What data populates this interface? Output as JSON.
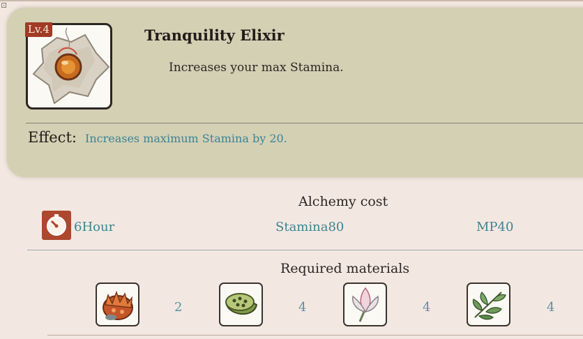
{
  "item": {
    "level_badge": "Lv.4",
    "name": "Tranquility Elixir",
    "description": "Increases your max Stamina.",
    "icon": "elixir-icon",
    "effect_label": "Effect:",
    "effect_text": "Increases maximum Stamina by 20."
  },
  "alchemy_cost": {
    "title": "Alchemy cost",
    "time_icon": "clock-icon",
    "time": "6Hour",
    "stamina": "Stamina80",
    "mp": "MP40"
  },
  "materials": {
    "title": "Required materials",
    "items": [
      {
        "icon": "fire-fruit-icon",
        "count": "2"
      },
      {
        "icon": "lotus-seedpod-icon",
        "count": "4"
      },
      {
        "icon": "lotus-bud-icon",
        "count": "4"
      },
      {
        "icon": "herb-leaves-icon",
        "count": "4"
      }
    ]
  },
  "colors": {
    "panel": "#d4d0b4",
    "background": "#f3e8e1",
    "accent_text": "#3c8394",
    "badge": "#a03b25"
  }
}
